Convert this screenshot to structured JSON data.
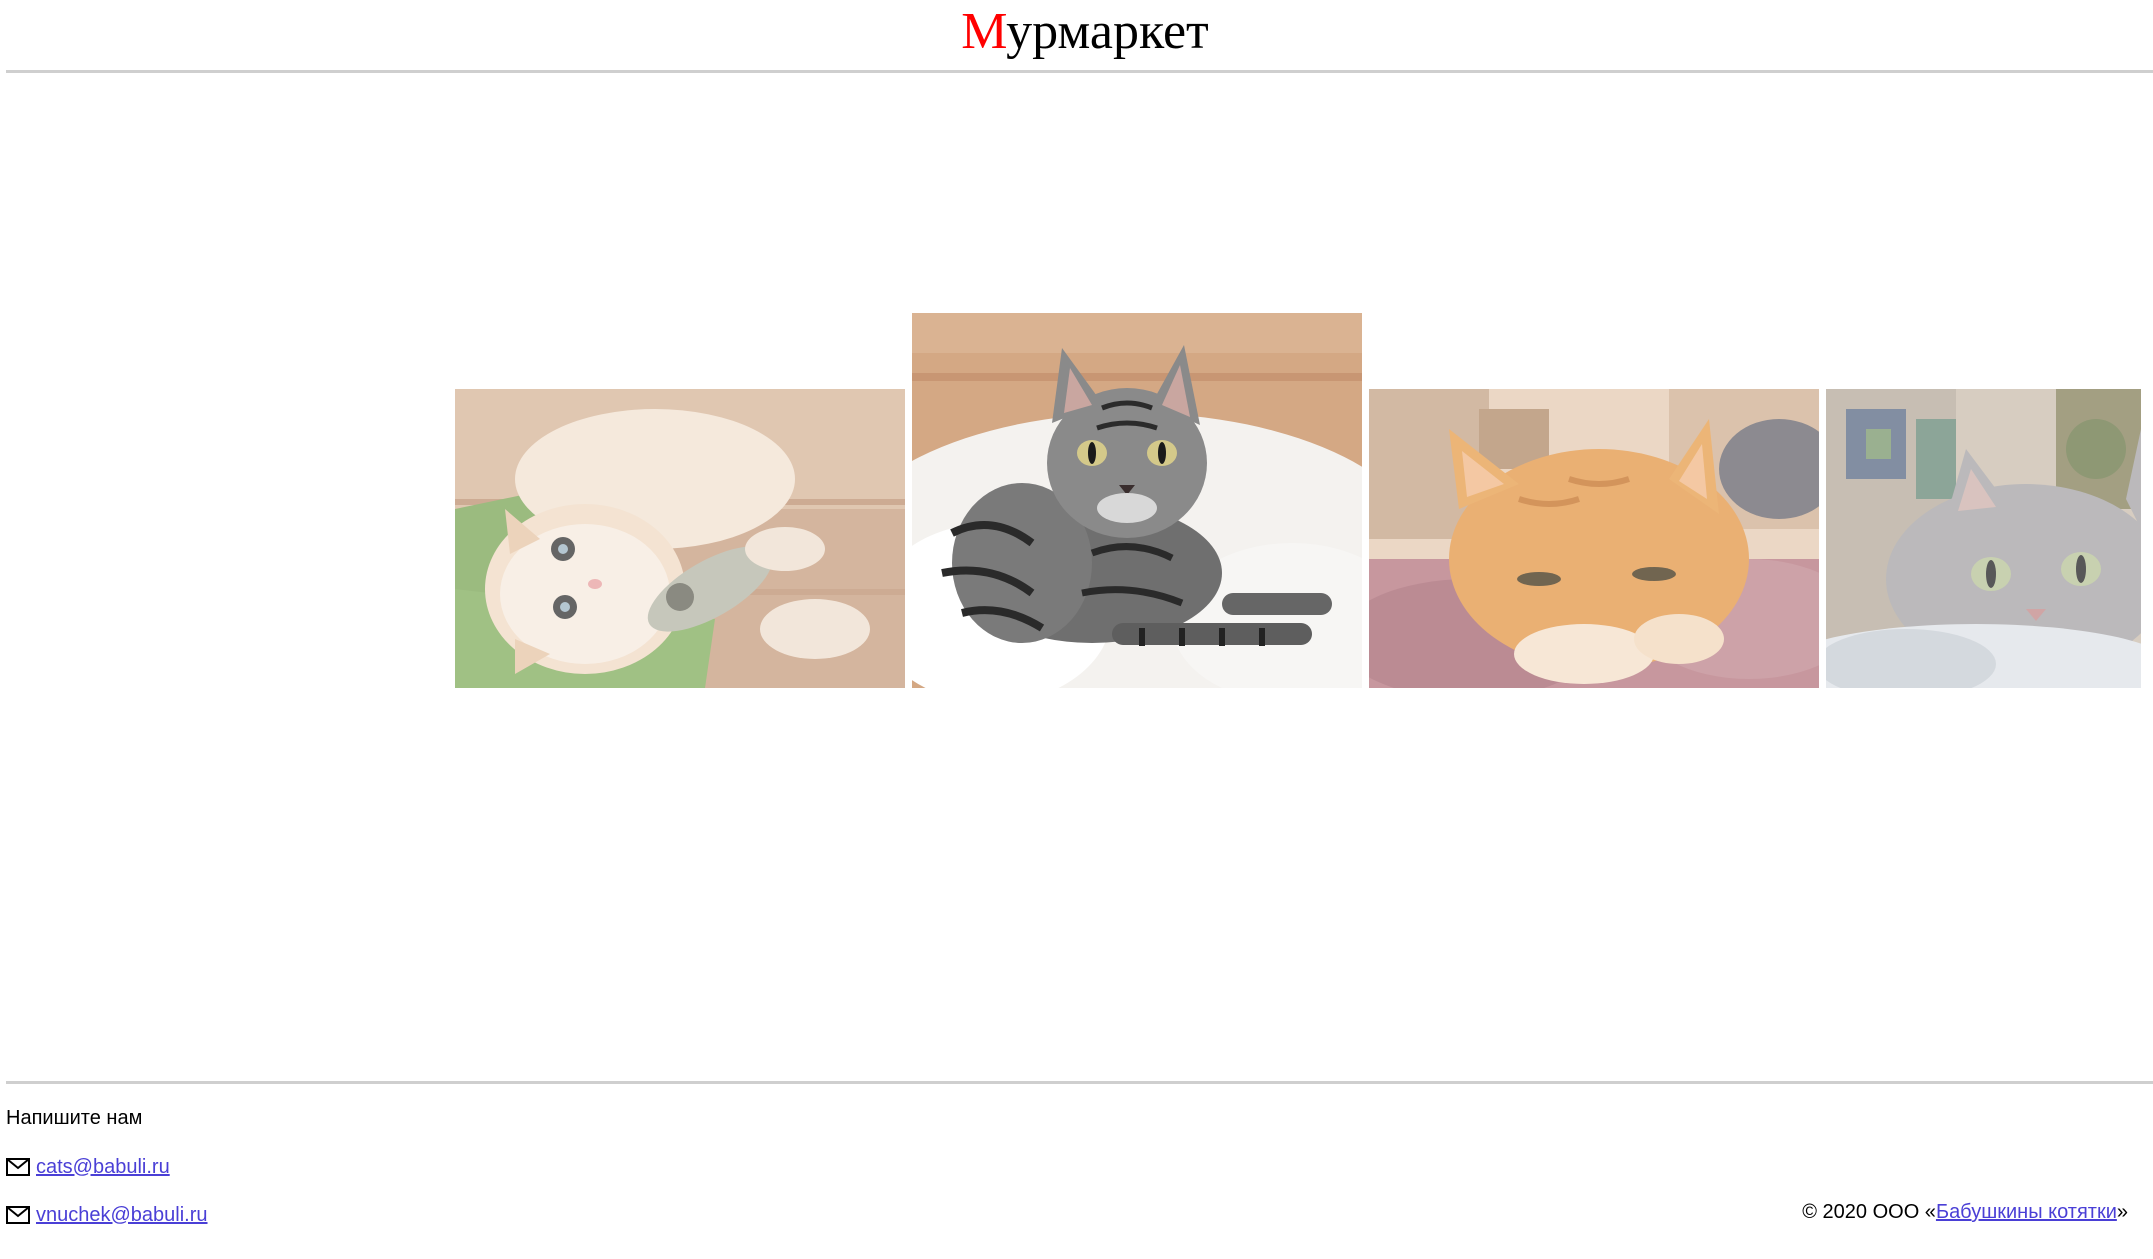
{
  "header": {
    "title_first_letter": "М",
    "title_rest": "урмаркет",
    "accent_color": "#ff0000"
  },
  "gallery": {
    "images": [
      {
        "name": "cream-cat-with-fish-toy"
      },
      {
        "name": "tabby-cat-on-fur-rug"
      },
      {
        "name": "ginger-cat-on-bed"
      },
      {
        "name": "grey-cat-peeking"
      }
    ]
  },
  "footer": {
    "contact_heading": "Напишите нам",
    "emails": [
      "cats@babuli.ru",
      "vnuchek@babuli.ru"
    ],
    "copyright_prefix": "© 2020 ООО «",
    "company_name": "Бабушкины котятки",
    "copyright_suffix": "»",
    "link_color": "#4a3fd6"
  }
}
